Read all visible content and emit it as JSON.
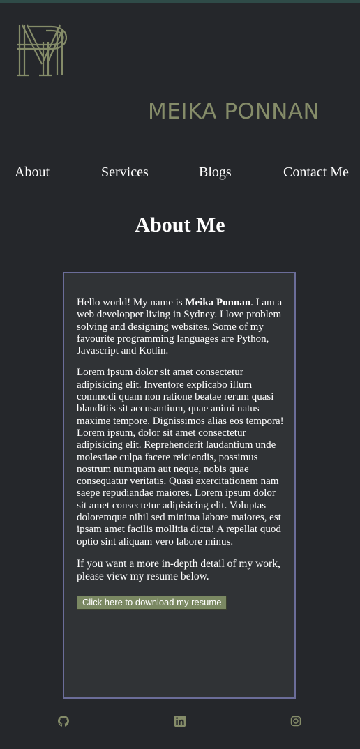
{
  "brand": {
    "name": "MEIKA PONNAN",
    "logo_icon": "mp-monogram-logo",
    "accent_color": "#858c69"
  },
  "nav": {
    "items": [
      {
        "label": "About"
      },
      {
        "label": "Services"
      },
      {
        "label": "Blogs"
      },
      {
        "label": "Contact Me"
      }
    ]
  },
  "about": {
    "title": "About Me",
    "intro_prefix": "Hello world! My name is ",
    "intro_name": "Meika Ponnan",
    "intro_suffix": ". I am a web developper living in Sydney. I love problem solving and designing websites. Some of my favourite programming languages are Python, Javascript and Kotlin.",
    "lorem": "Lorem ipsum dolor sit amet consectetur adipisicing elit. Inventore explicabo illum commodi quam non ratione beatae rerum quasi blanditiis sit accusantium, quae animi natus maxime tempore. Dignissimos alias eos tempora! Lorem ipsum, dolor sit amet consectetur adipisicing elit. Reprehenderit laudantium unde molestiae culpa facere reiciendis, possimus nostrum numquam aut neque, nobis quae consequatur veritatis. Quasi exercitationem nam saepe repudiandae maiores. Lorem ipsum dolor sit amet consectetur adipisicing elit. Voluptas doloremque nihil sed minima labore maiores, est ipsam amet facilis mollitia dicta! A repellat quod optio sint aliquam vero labore minus.",
    "resume_note": "If you want a more in-depth detail of my work, please view my resume below.",
    "download_label": "Click here to download my resume",
    "card_border_color": "#6b6d99"
  },
  "footer": {
    "social": [
      {
        "icon": "github-icon"
      },
      {
        "icon": "linkedin-icon"
      },
      {
        "icon": "instagram-icon"
      }
    ]
  }
}
